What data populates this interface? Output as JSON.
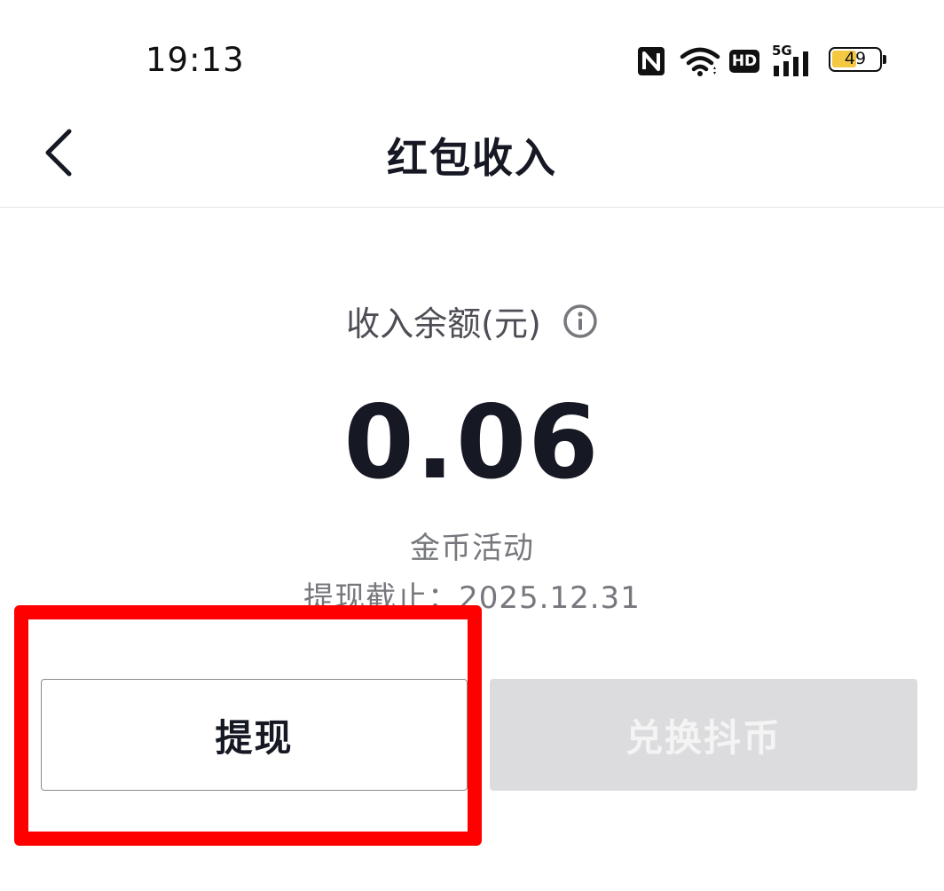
{
  "status_bar": {
    "time": "19:13",
    "battery_level": "49",
    "network_label": "5G",
    "hd_label": "HD",
    "icons": [
      "nfc-icon",
      "wifi-icon",
      "hd-icon",
      "signal-5g-icon",
      "battery-icon"
    ]
  },
  "header": {
    "title": "红包收入",
    "back_icon": "chevron-left-icon"
  },
  "balance": {
    "label": "收入余额(元)",
    "info_icon": "info-icon",
    "amount": "0.06",
    "activity": "金币活动",
    "deadline": "提现截止：2025.12.31"
  },
  "actions": {
    "withdraw_label": "提现",
    "exchange_label": "兑换抖币"
  },
  "colors": {
    "highlight": "#ff0000",
    "disabled_button_bg": "#dcdcde",
    "battery_fill": "#f5c842"
  }
}
